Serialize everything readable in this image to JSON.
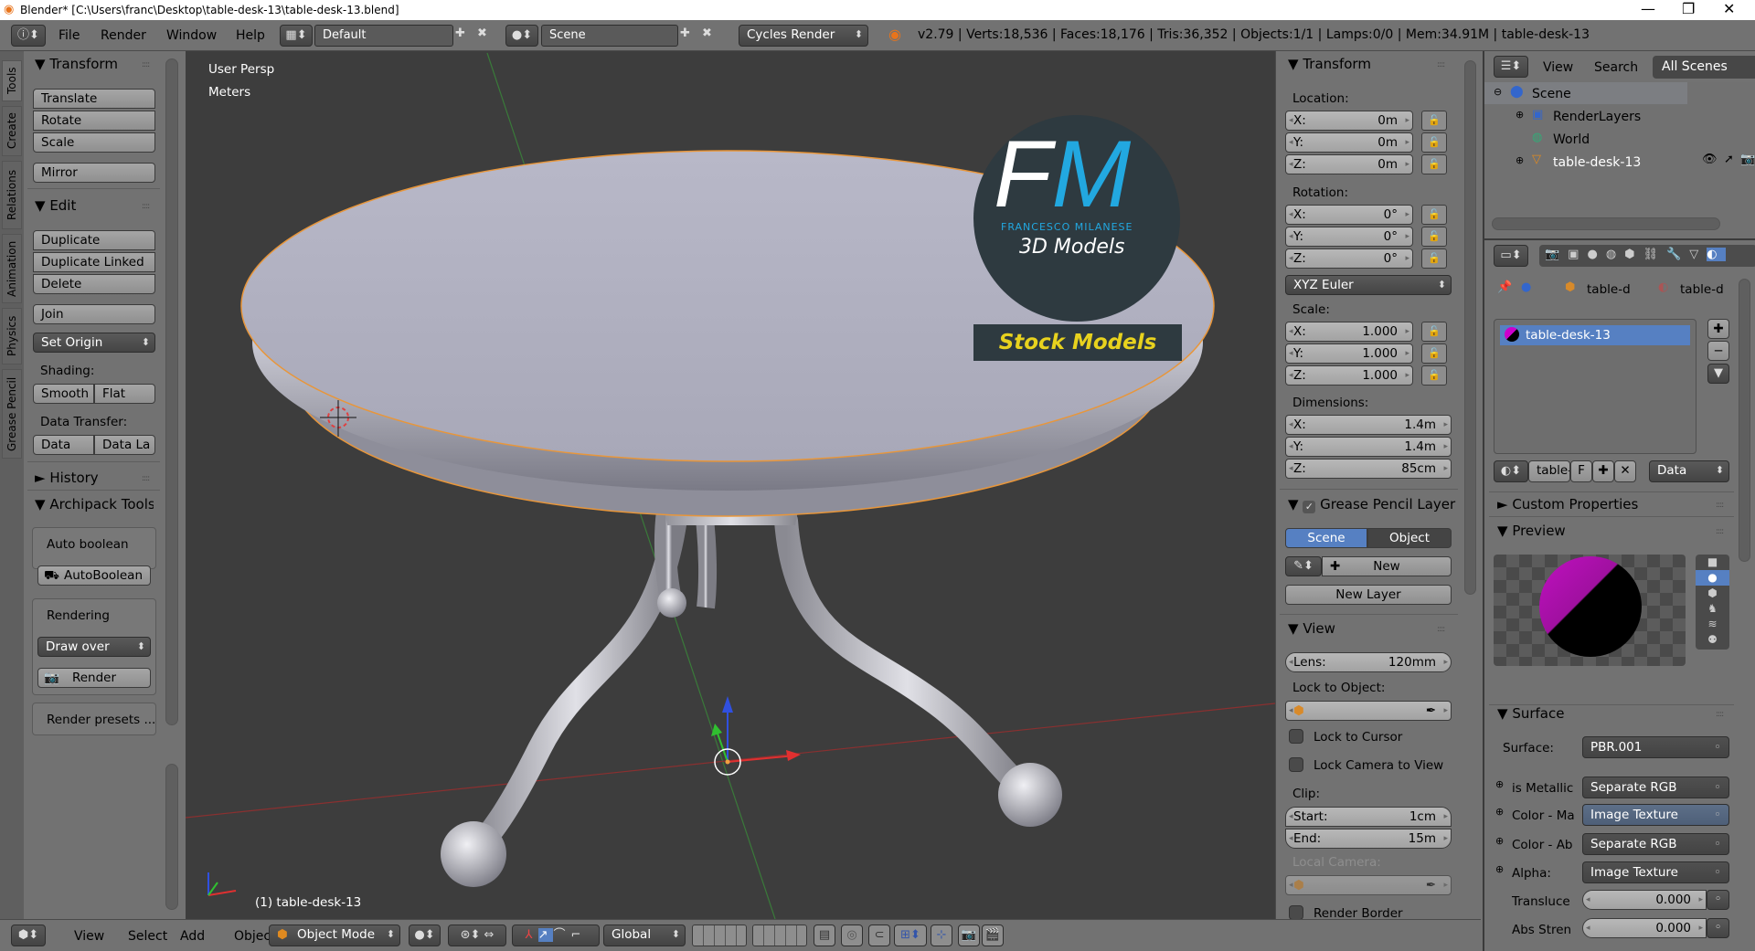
{
  "window": {
    "title": "Blender* [C:\\Users\\franc\\Desktop\\table-desk-13\\table-desk-13.blend]",
    "minimize": "—",
    "restore": "❐",
    "close": "✕"
  },
  "menu": {
    "file": "File",
    "render": "Render",
    "window": "Window",
    "help": "Help"
  },
  "topbar": {
    "layout": "Default",
    "scene": "Scene",
    "engine": "Cycles Render",
    "stats": "v2.79 | Verts:18,536 | Faces:18,176 | Tris:36,352 | Objects:1/1 | Lamps:0/0 | Mem:34.91M | table-desk-13"
  },
  "tabs": [
    "Tools",
    "Create",
    "Relations",
    "Animation",
    "Physics",
    "Grease Pencil"
  ],
  "tools": {
    "transform": "Transform",
    "translate": "Translate",
    "rotate": "Rotate",
    "scale": "Scale",
    "mirror": "Mirror",
    "edit": "Edit",
    "duplicate": "Duplicate",
    "duplicate_linked": "Duplicate Linked",
    "delete": "Delete",
    "join": "Join",
    "set_origin": "Set Origin",
    "shading": "Shading:",
    "smooth": "Smooth",
    "flat": "Flat",
    "data_transfer": "Data Transfer:",
    "data": "Data",
    "data_la": "Data La",
    "history": "History",
    "archipack": "Archipack Tools",
    "auto_boolean": "Auto boolean",
    "autoboolean_btn": "AutoBoolean",
    "rendering": "Rendering",
    "draw_over": "Draw over",
    "render": "Render",
    "render_presets": "Render presets ..."
  },
  "viewport": {
    "view_name": "User Persp",
    "units": "Meters",
    "object_label": "(1) table-desk-13",
    "logo_fm": "FM",
    "logo_name": "FRANCESCO MILANESE",
    "logo_sub": "3D Models",
    "logo_stock": "Stock Models"
  },
  "npanel": {
    "transform": "Transform",
    "location": "Location:",
    "loc": [
      {
        "axis": "X:",
        "value": "0m"
      },
      {
        "axis": "Y:",
        "value": "0m"
      },
      {
        "axis": "Z:",
        "value": "0m"
      }
    ],
    "rotation": "Rotation:",
    "rot": [
      {
        "axis": "X:",
        "value": "0°"
      },
      {
        "axis": "Y:",
        "value": "0°"
      },
      {
        "axis": "Z:",
        "value": "0°"
      }
    ],
    "rotation_mode": "XYZ Euler",
    "scale": "Scale:",
    "scl": [
      {
        "axis": "X:",
        "value": "1.000"
      },
      {
        "axis": "Y:",
        "value": "1.000"
      },
      {
        "axis": "Z:",
        "value": "1.000"
      }
    ],
    "dimensions": "Dimensions:",
    "dim": [
      {
        "axis": "X:",
        "value": "1.4m"
      },
      {
        "axis": "Y:",
        "value": "1.4m"
      },
      {
        "axis": "Z:",
        "value": "85cm"
      }
    ],
    "grease_pencil": "Grease Pencil Layer",
    "gp_scene": "Scene",
    "gp_object": "Object",
    "gp_new": "New",
    "gp_new_layer": "New Layer",
    "view": "View",
    "lens_label": "Lens:",
    "lens_value": "120mm",
    "lock_to_object": "Lock to Object:",
    "lock_to_cursor": "Lock to Cursor",
    "lock_camera": "Lock Camera to View",
    "clip": "Clip:",
    "clip_start_label": "Start:",
    "clip_start": "1cm",
    "clip_end_label": "End:",
    "clip_end": "15m",
    "local_camera": "Local Camera:",
    "render_border": "Render Border"
  },
  "outliner": {
    "view": "View",
    "search": "Search",
    "filter": "All Scenes",
    "items": [
      "Scene",
      "RenderLayers",
      "World",
      "table-desk-13"
    ]
  },
  "properties": {
    "crumb1": "table-d",
    "crumb2": "table-d",
    "slot": "table-desk-13",
    "mat_name": "table-",
    "fake": "F",
    "link": "Data",
    "custom_props": "Custom Properties",
    "preview": "Preview",
    "surface_panel": "Surface",
    "surface_label": "Surface:",
    "surface_value": "PBR.001",
    "inputs": [
      {
        "label": "is Metallic",
        "value": "Separate RGB"
      },
      {
        "label": "Color - Ma",
        "value": "Image Texture"
      },
      {
        "label": "Color - Ab",
        "value": "Separate RGB"
      },
      {
        "label": "Alpha:",
        "value": "Image Texture"
      }
    ],
    "transluce_label": "Transluce",
    "transluce_value": "0.000",
    "abs_label": "Abs Stren",
    "abs_value": "0.000"
  },
  "bottombar": {
    "view": "View",
    "select": "Select",
    "add": "Add",
    "object": "Object",
    "mode": "Object Mode",
    "orientation": "Global"
  },
  "colors": {
    "accent": "#5680c2",
    "viewport": "#3d3d3d",
    "selection": "#f0a040"
  }
}
